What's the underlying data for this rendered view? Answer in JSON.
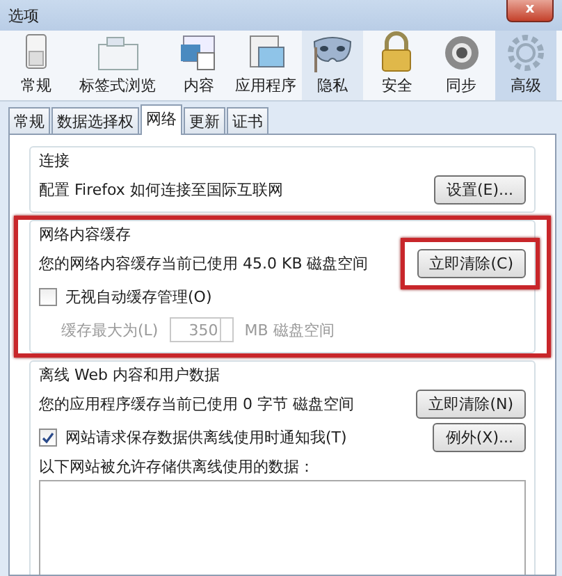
{
  "window": {
    "title": "选项",
    "close": "x"
  },
  "toolbar": [
    {
      "label": "常规",
      "kind": "switch",
      "selected": false,
      "hovered": false
    },
    {
      "label": "标签式浏览",
      "kind": "tabs",
      "selected": false,
      "hovered": false
    },
    {
      "label": "内容",
      "kind": "content",
      "selected": false,
      "hovered": false
    },
    {
      "label": "应用程序",
      "kind": "apps",
      "selected": false,
      "hovered": false
    },
    {
      "label": "隐私",
      "kind": "mask",
      "selected": false,
      "hovered": true
    },
    {
      "label": "安全",
      "kind": "lock",
      "selected": false,
      "hovered": false
    },
    {
      "label": "同步",
      "kind": "sync",
      "selected": false,
      "hovered": false
    },
    {
      "label": "高级",
      "kind": "gear",
      "selected": true,
      "hovered": false
    }
  ],
  "tabs": [
    {
      "label": "常规",
      "selected": false
    },
    {
      "label": "数据选择权",
      "selected": false
    },
    {
      "label": "网络",
      "selected": true
    },
    {
      "label": "更新",
      "selected": false
    },
    {
      "label": "证书",
      "selected": false
    }
  ],
  "sections": [
    {
      "title": "连接",
      "highlighted": false,
      "rows": [
        {
          "kind": "text_button",
          "text": "配置 Firefox 如何连接至国际互联网",
          "button": "设置(E)...",
          "button_highlighted": false
        }
      ]
    },
    {
      "title": "网络内容缓存",
      "highlighted": true,
      "rows": [
        {
          "kind": "text_button",
          "text": "您的网络内容缓存当前已使用 45.0 KB 磁盘空间",
          "button": "立即清除(C)",
          "button_highlighted": true
        },
        {
          "kind": "checkbox",
          "label": "无视自动缓存管理(O)",
          "checked": false
        },
        {
          "kind": "spin",
          "label": "缓存最大为(L)",
          "value": "350",
          "unit": "MB 磁盘空间",
          "disabled": true
        }
      ]
    },
    {
      "title": "离线 Web 内容和用户数据",
      "highlighted": false,
      "rows": [
        {
          "kind": "text_button",
          "text": "您的应用程序缓存当前已使用 0 字节 磁盘空间",
          "button": "立即清除(N)",
          "button_highlighted": false
        },
        {
          "kind": "checkbox",
          "label": "网站请求保存数据供离线使用时通知我(T)",
          "checked": true,
          "button": "例外(X)..."
        },
        {
          "kind": "label",
          "text": "以下网站被允许存储供离线使用的数据："
        },
        {
          "kind": "listbox"
        }
      ]
    }
  ]
}
